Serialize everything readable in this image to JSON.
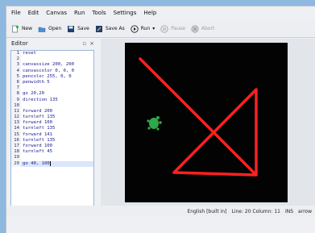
{
  "menubar": {
    "items": [
      "File",
      "Edit",
      "Canvas",
      "Run",
      "Tools",
      "Settings",
      "Help"
    ]
  },
  "toolbar": {
    "new_label": "New",
    "open_label": "Open",
    "save_label": "Save",
    "save_as_label": "Save As",
    "run_label": "Run",
    "pause_label": "Pause",
    "abort_label": "Abort"
  },
  "editor": {
    "title": "Editor",
    "lines": [
      {
        "n": "1",
        "text": "reset"
      },
      {
        "n": "2",
        "text": ""
      },
      {
        "n": "3",
        "text": "canvassize 200, 200"
      },
      {
        "n": "4",
        "text": "canvascolor 0, 0, 0"
      },
      {
        "n": "5",
        "text": "pencolor 255, 0, 0"
      },
      {
        "n": "6",
        "text": "penwidth 5"
      },
      {
        "n": "7",
        "text": ""
      },
      {
        "n": "8",
        "text": "go 20,20"
      },
      {
        "n": "9",
        "text": "direction 135"
      },
      {
        "n": "10",
        "text": ""
      },
      {
        "n": "11",
        "text": "forward 200"
      },
      {
        "n": "12",
        "text": "turnleft 135"
      },
      {
        "n": "13",
        "text": "forward 100"
      },
      {
        "n": "14",
        "text": "turnleft 135"
      },
      {
        "n": "15",
        "text": "forward 141"
      },
      {
        "n": "16",
        "text": "turnleft 135"
      },
      {
        "n": "17",
        "text": "forward 100"
      },
      {
        "n": "18",
        "text": "turnleft 45"
      },
      {
        "n": "19",
        "text": ""
      },
      {
        "n": "20",
        "text": "go 40, 100"
      }
    ]
  },
  "status": {
    "language": "English [built in]",
    "position": "Line: 20 Column: 11",
    "mode": "INS",
    "extra": "arrow"
  },
  "colors": {
    "canvas_bg": "#000000",
    "pen": "#ff2020",
    "turtle": "#2fa84a"
  }
}
